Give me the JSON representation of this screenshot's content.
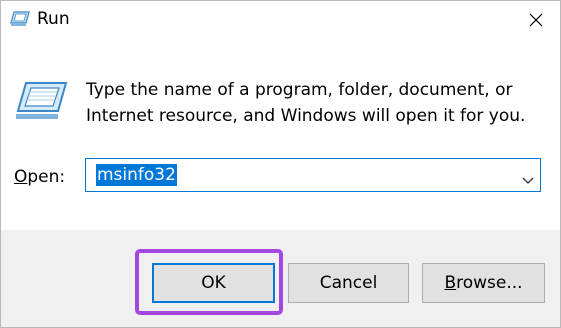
{
  "window": {
    "title": "Run",
    "close_icon": "close-icon",
    "title_icon": "run-app-icon"
  },
  "content": {
    "icon": "run-app-icon",
    "description": "Type the name of a program, folder, document, or Internet resource, and Windows will open it for you."
  },
  "open": {
    "label_prefix": "",
    "label_accel": "O",
    "label_rest": "pen:",
    "value": "msinfo32",
    "dropdown_icon": "chevron-down-icon"
  },
  "buttons": {
    "ok": "OK",
    "cancel": "Cancel",
    "browse_accel": "B",
    "browse_rest": "rowse..."
  },
  "colors": {
    "accent": "#0078d7",
    "highlight": "#a347e0",
    "footer": "#f0f0f0"
  }
}
